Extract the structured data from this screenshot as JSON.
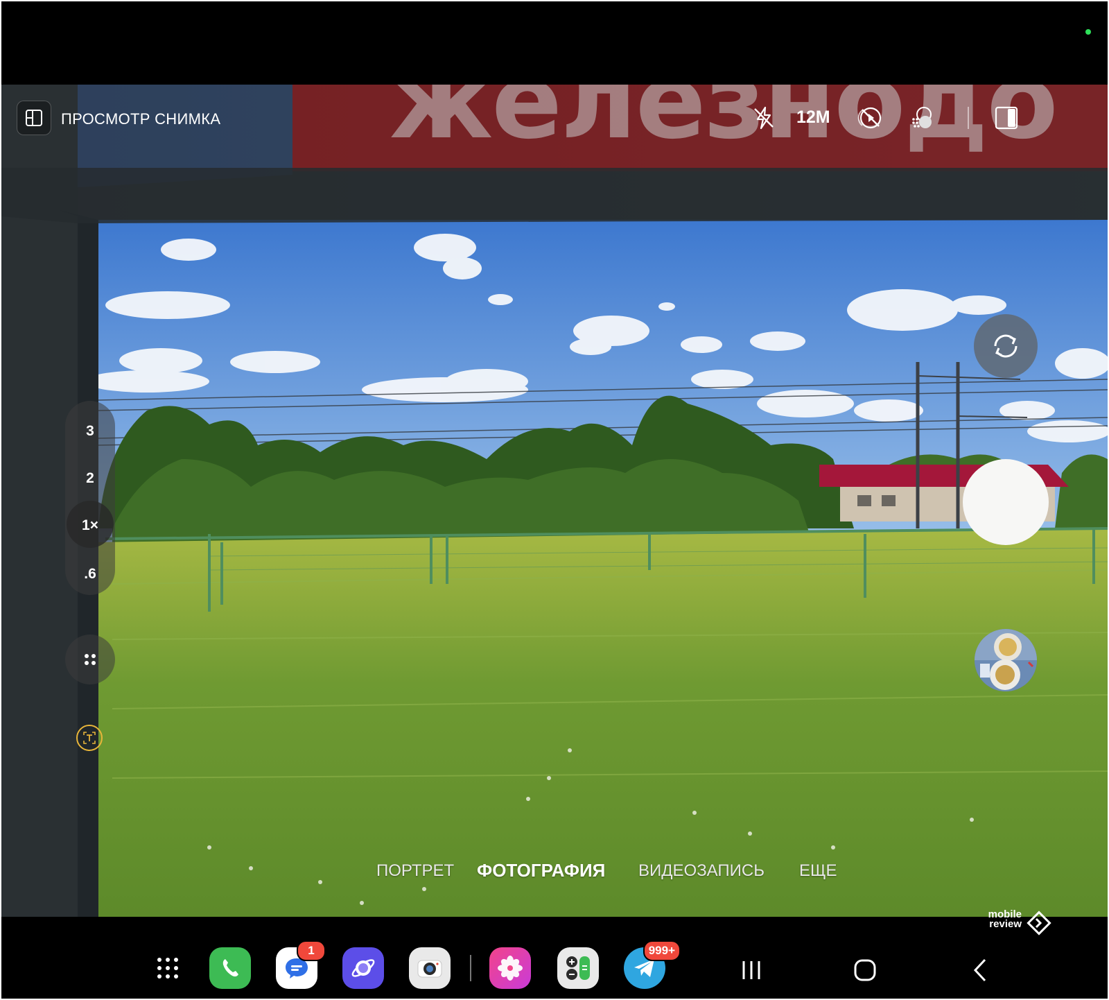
{
  "top_bar": {
    "preview_label": "ПРОСМОТР СНИМКА",
    "resolution": "12M",
    "icons": [
      "layout-icon",
      "flash-off-icon",
      "motion-photo-off-icon",
      "filter-icon",
      "aspect-ratio-icon"
    ]
  },
  "viewfinder": {
    "sign_text": "железнодо"
  },
  "zoom": {
    "levels": [
      {
        "label": "3"
      },
      {
        "label": "2"
      },
      {
        "label": "1×",
        "active": true
      },
      {
        "label": ".6"
      }
    ]
  },
  "modes": {
    "items": [
      {
        "label": "ПОРТРЕТ"
      },
      {
        "label": "ФОТОГРАФИЯ",
        "active": true
      },
      {
        "label": "ВИДЕОЗАПИСЬ"
      },
      {
        "label": "ЕЩЕ"
      }
    ]
  },
  "watermark": {
    "line1": "mobile",
    "line2": "review"
  },
  "dock": {
    "apps": [
      {
        "name": "app-drawer",
        "icon": "grid-dots-icon"
      },
      {
        "name": "phone",
        "icon": "phone-icon",
        "color": "#3dbb54"
      },
      {
        "name": "messages",
        "icon": "chat-bubble-icon",
        "color": "#ffffff",
        "badge": "1"
      },
      {
        "name": "internet",
        "icon": "planet-icon",
        "color": "#5c4ee8"
      },
      {
        "name": "camera",
        "icon": "camera-icon",
        "color": "#e9e9e9"
      },
      {
        "name": "gallery",
        "icon": "flower-icon",
        "color": "#e8458a"
      },
      {
        "name": "calculator",
        "icon": "calculator-icon",
        "color": "#e9e9e9"
      },
      {
        "name": "telegram",
        "icon": "paper-plane-icon",
        "color": "#2fa6e0",
        "badge": "999+"
      }
    ],
    "nav": [
      "recents-icon",
      "home-icon",
      "back-icon"
    ]
  },
  "colors": {
    "sky": "#5d93d8",
    "grass": "#7da83a",
    "shutter": "#f7f7f5",
    "badge": "#f0483b",
    "text_scan_accent": "#e8b53a"
  }
}
